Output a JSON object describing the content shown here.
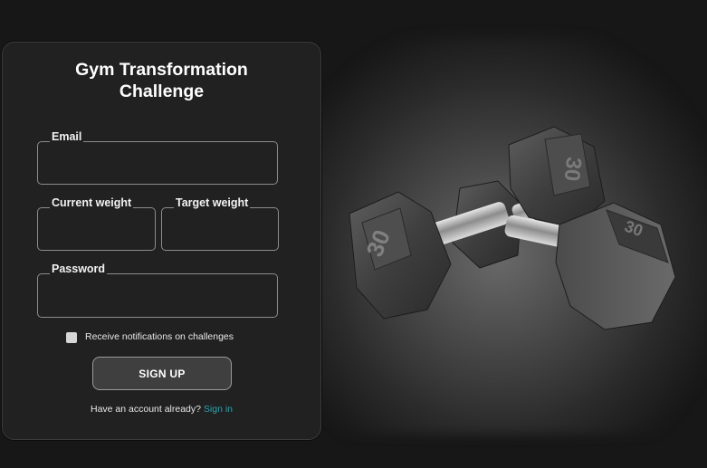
{
  "form": {
    "title_line1": "Gym Transformation",
    "title_line2": "Challenge",
    "email_label": "Email",
    "email_value": "",
    "current_weight_label": "Current weight",
    "current_weight_value": "",
    "target_weight_label": "Target weight",
    "target_weight_value": "",
    "password_label": "Password",
    "password_value": "",
    "notifications_label": "Receive notifications on challenges",
    "notifications_checked": false,
    "signup_label": "SIGN UP",
    "footer_prompt": "Have an account already?",
    "signin_label": "Sign in"
  },
  "hero": {
    "image_icon": "dumbbells-image",
    "weight_marking": "30"
  },
  "colors": {
    "page_background": "#171717",
    "card_background": "#212121",
    "link": "#27a3b0",
    "field_border": "#8c8c8c"
  }
}
